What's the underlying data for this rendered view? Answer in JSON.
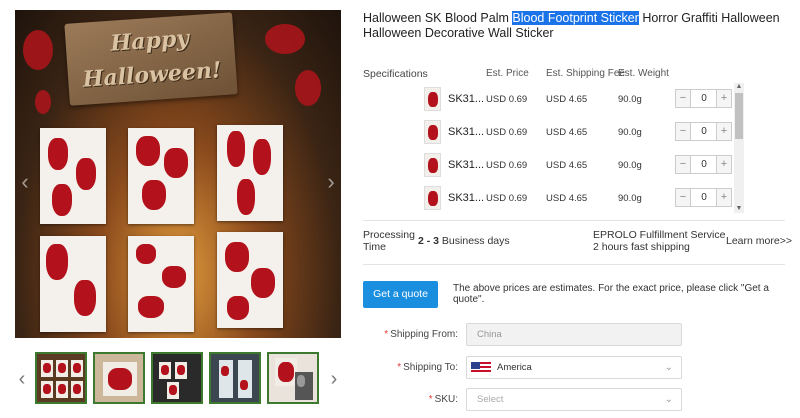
{
  "product": {
    "title_before": "Halloween SK Blood Palm ",
    "title_highlight": "Blood Footprint Sticker",
    "title_after": " Horror Graffiti Halloween Halloween Decorative Wall Sticker",
    "image_sign_line1": "Happy",
    "image_sign_line2": "Halloween!"
  },
  "gallery": {
    "prev_icon": "chevron-left-icon",
    "next_icon": "chevron-right-icon",
    "thumbnail_count": 5,
    "active_thumbnail": 5
  },
  "specs": {
    "headers": {
      "specifications": "Specifications",
      "price": "Est. Price",
      "shipping_fee": "Est. Shipping Fee",
      "weight": "Est. Weight"
    },
    "rows": [
      {
        "sku": "SK31...",
        "price": "USD 0.69",
        "shipping": "USD 4.65",
        "weight": "90.0g",
        "qty": "0"
      },
      {
        "sku": "SK31...",
        "price": "USD 0.69",
        "shipping": "USD 4.65",
        "weight": "90.0g",
        "qty": "0"
      },
      {
        "sku": "SK31...",
        "price": "USD 0.69",
        "shipping": "USD 4.65",
        "weight": "90.0g",
        "qty": "0"
      },
      {
        "sku": "SK31...",
        "price": "USD 0.69",
        "shipping": "USD 4.65",
        "weight": "90.0g",
        "qty": "0"
      }
    ],
    "minus": "−",
    "plus": "+"
  },
  "processing": {
    "label_line1": "Processing",
    "label_line2": "Time",
    "days": "2 - 3",
    "days_suffix": " Business days",
    "service_line1": "EPROLO Fulfillment Service",
    "service_line2": "2 hours fast shipping",
    "learn_more": "Learn more>>"
  },
  "quote": {
    "button": "Get a quote",
    "note": "The above prices are estimates. For the exact price, please click \"Get a quote\"."
  },
  "form": {
    "shipping_from_label": "Shipping From:",
    "shipping_from_value": "China",
    "shipping_to_label": "Shipping To:",
    "shipping_to_value": "America",
    "sku_label": "SKU:",
    "sku_placeholder": "Select",
    "required_mark": "*"
  },
  "colors": {
    "accent": "#1a8fe0",
    "highlight": "#1a73e8",
    "thumb_border": "#3d7a2f",
    "required": "#e53935"
  }
}
